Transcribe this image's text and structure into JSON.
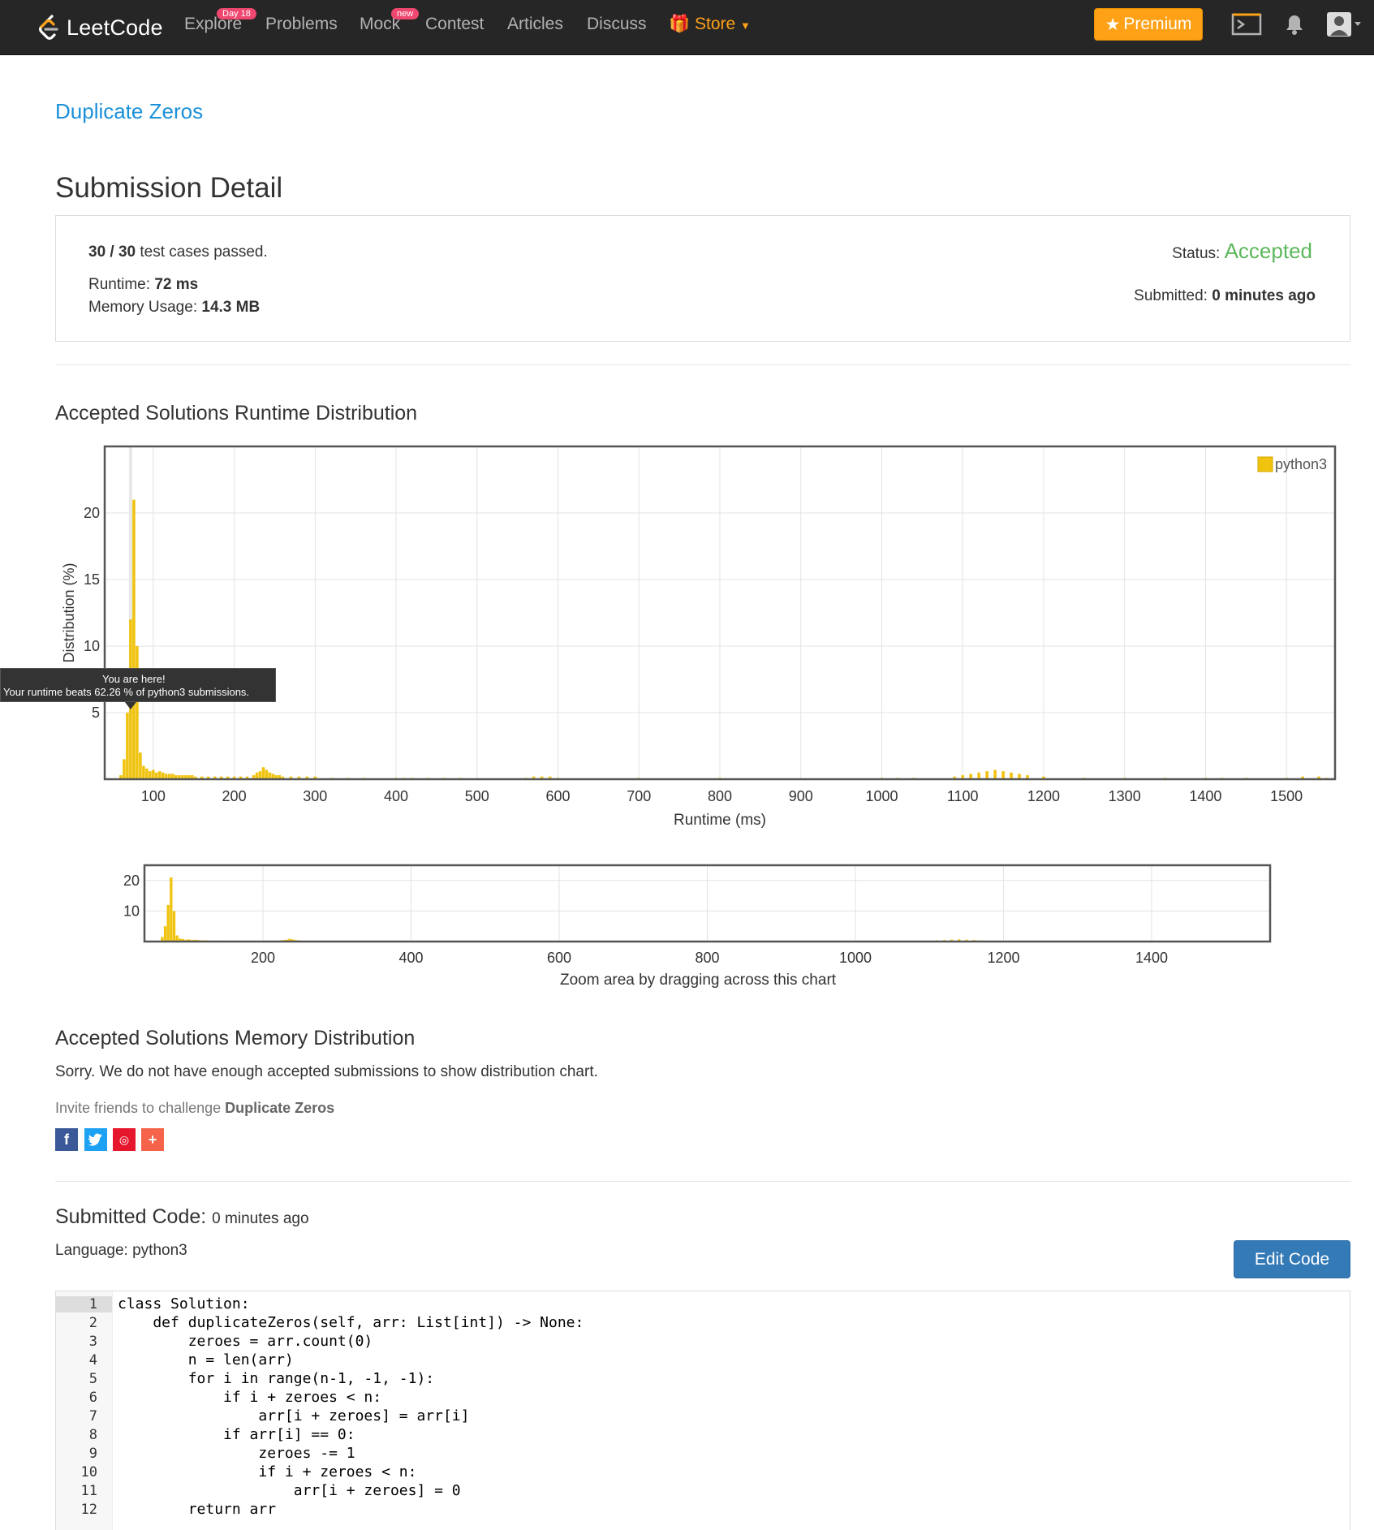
{
  "nav": {
    "logo_text": "LeetCode",
    "explore": "Explore",
    "explore_badge": "Day 18",
    "problems": "Problems",
    "mock": "Mock",
    "mock_badge": "new",
    "contest": "Contest",
    "articles": "Articles",
    "discuss": "Discuss",
    "store": "Store",
    "premium": "Premium"
  },
  "problem": {
    "title": "Duplicate Zeros"
  },
  "submission": {
    "heading": "Submission Detail",
    "cases_passed": "30 / 30",
    "cases_suffix": "test cases passed.",
    "runtime_label": "Runtime:",
    "runtime_value": "72 ms",
    "memory_label": "Memory Usage:",
    "memory_value": "14.3 MB",
    "status_label": "Status:",
    "status_value": "Accepted",
    "submitted_label": "Submitted:",
    "submitted_value": "0 minutes ago"
  },
  "runtime_dist": {
    "heading": "Accepted Solutions Runtime Distribution",
    "tooltip_line1": "You are here!",
    "tooltip_line2": "Your runtime beats 62.26 % of python3 submissions.",
    "zoom_caption": "Zoom area by dragging across this chart"
  },
  "chart_data": [
    {
      "type": "bar",
      "xlabel": "Runtime (ms)",
      "ylabel": "Distribution (%)",
      "xlim": [
        40,
        1560
      ],
      "ylim": [
        0,
        25
      ],
      "xticks": [
        100,
        200,
        300,
        400,
        500,
        600,
        700,
        800,
        900,
        1000,
        1100,
        1200,
        1300,
        1400,
        1500
      ],
      "yticks": [
        5,
        10,
        15,
        20
      ],
      "legend": "top-right",
      "grid": true,
      "series": [
        {
          "name": "python3",
          "color": "#f0c30f",
          "x": [
            60,
            64,
            68,
            72,
            76,
            80,
            84,
            88,
            92,
            96,
            100,
            104,
            108,
            112,
            116,
            120,
            124,
            128,
            132,
            136,
            140,
            144,
            148,
            152,
            160,
            168,
            176,
            184,
            192,
            200,
            208,
            216,
            224,
            228,
            232,
            236,
            240,
            244,
            248,
            252,
            256,
            260,
            270,
            280,
            290,
            300,
            320,
            340,
            360,
            400,
            410,
            420,
            440,
            460,
            480,
            560,
            570,
            580,
            590,
            600,
            700,
            800,
            1000,
            1020,
            1040,
            1090,
            1100,
            1110,
            1120,
            1130,
            1140,
            1150,
            1160,
            1170,
            1180,
            1200,
            1250,
            1300,
            1350,
            1400,
            1420,
            1450,
            1500,
            1520,
            1540,
            1550
          ],
          "values": [
            0.3,
            1.5,
            5,
            12,
            21,
            10,
            2,
            1,
            0.8,
            0.6,
            0.7,
            0.5,
            0.6,
            0.5,
            0.4,
            0.4,
            0.4,
            0.3,
            0.3,
            0.3,
            0.3,
            0.3,
            0.3,
            0.2,
            0.2,
            0.2,
            0.2,
            0.2,
            0.2,
            0.2,
            0.2,
            0.2,
            0.3,
            0.5,
            0.6,
            0.9,
            0.7,
            0.5,
            0.4,
            0.3,
            0.3,
            0.2,
            0.2,
            0.2,
            0.2,
            0.2,
            0.1,
            0.1,
            0.1,
            0.1,
            0.1,
            0.1,
            0.1,
            0.1,
            0.1,
            0.1,
            0.2,
            0.2,
            0.2,
            0.1,
            0.1,
            0.1,
            0.1,
            0.1,
            0.1,
            0.2,
            0.3,
            0.4,
            0.5,
            0.6,
            0.7,
            0.6,
            0.5,
            0.4,
            0.3,
            0.2,
            0.1,
            0.1,
            0.1,
            0.1,
            0.1,
            0.1,
            0.1,
            0.2,
            0.2,
            0.1
          ]
        }
      ]
    },
    {
      "type": "bar",
      "xlim": [
        40,
        1560
      ],
      "ylim": [
        0,
        25
      ],
      "xticks": [
        200,
        400,
        600,
        800,
        1000,
        1200,
        1400
      ],
      "yticks": [
        10,
        20
      ]
    }
  ],
  "memory_dist": {
    "heading": "Accepted Solutions Memory Distribution",
    "message": "Sorry. We do not have enough accepted submissions to show distribution chart.",
    "invite_prefix": "Invite friends to challenge",
    "invite_problem": "Duplicate Zeros"
  },
  "submitted_code": {
    "heading": "Submitted Code:",
    "time": "0 minutes ago",
    "language_label": "Language:",
    "language_value": "python3",
    "edit_button": "Edit Code",
    "lines": [
      "class Solution:",
      "    def duplicateZeros(self, arr: List[int]) -> None:",
      "        zeroes = arr.count(0)",
      "        n = len(arr)",
      "        for i in range(n-1, -1, -1):",
      "            if i + zeroes < n:",
      "                arr[i + zeroes] = arr[i]",
      "            if arr[i] == 0:",
      "                zeroes -= 1",
      "                if i + zeroes < n:",
      "                    arr[i + zeroes] = 0",
      "        return arr"
    ]
  }
}
